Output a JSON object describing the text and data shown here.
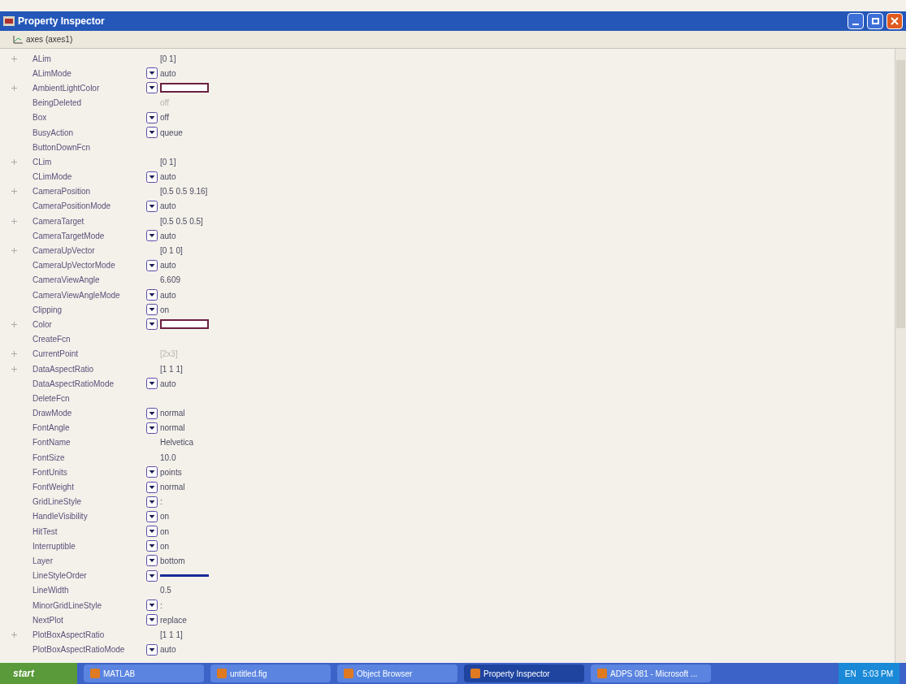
{
  "window": {
    "title": "Property Inspector"
  },
  "object": {
    "label": "axes (axes1)"
  },
  "properties": [
    {
      "name": "ALim",
      "kind": "text",
      "value": "[0 1]",
      "expanded": false,
      "disabled": false
    },
    {
      "name": "ALimMode",
      "kind": "dropdown",
      "value": "auto",
      "disabled": false
    },
    {
      "name": "AmbientLightColor",
      "kind": "color",
      "color": "#ffffff",
      "expanded": false,
      "disabled": false
    },
    {
      "name": "BeingDeleted",
      "kind": "text",
      "value": "off",
      "disabled": true
    },
    {
      "name": "Box",
      "kind": "dropdown",
      "value": "off",
      "disabled": false
    },
    {
      "name": "BusyAction",
      "kind": "dropdown",
      "value": "queue",
      "disabled": false
    },
    {
      "name": "ButtonDownFcn",
      "kind": "text",
      "disabled": false
    },
    {
      "name": "CLim",
      "kind": "text",
      "value": "[0 1]",
      "expanded": false,
      "disabled": false
    },
    {
      "name": "CLimMode",
      "kind": "dropdown",
      "value": "auto",
      "disabled": false
    },
    {
      "name": "CameraPosition",
      "kind": "text",
      "value": "[0.5 0.5 9.16]",
      "expanded": false,
      "disabled": false
    },
    {
      "name": "CameraPositionMode",
      "kind": "dropdown",
      "value": "auto",
      "disabled": false
    },
    {
      "name": "CameraTarget",
      "kind": "text",
      "value": "[0.5 0.5 0.5]",
      "expanded": false,
      "disabled": false
    },
    {
      "name": "CameraTargetMode",
      "kind": "dropdown",
      "value": "auto",
      "disabled": false
    },
    {
      "name": "CameraUpVector",
      "kind": "text",
      "value": "[0 1 0]",
      "expanded": false,
      "disabled": false
    },
    {
      "name": "CameraUpVectorMode",
      "kind": "dropdown",
      "value": "auto",
      "disabled": false
    },
    {
      "name": "CameraViewAngle",
      "kind": "text",
      "value": "6.609",
      "disabled": false
    },
    {
      "name": "CameraViewAngleMode",
      "kind": "dropdown",
      "value": "auto",
      "disabled": false
    },
    {
      "name": "Clipping",
      "kind": "dropdown",
      "value": "on",
      "disabled": false
    },
    {
      "name": "Color",
      "kind": "color",
      "color": "#ffffff",
      "expanded": false,
      "disabled": false
    },
    {
      "name": "CreateFcn",
      "kind": "text",
      "disabled": false
    },
    {
      "name": "CurrentPoint",
      "kind": "text",
      "value": "[2x3]",
      "expanded": false,
      "disabled": true
    },
    {
      "name": "DataAspectRatio",
      "kind": "text",
      "value": "[1 1 1]",
      "expanded": false,
      "disabled": false
    },
    {
      "name": "DataAspectRatioMode",
      "kind": "dropdown",
      "value": "auto",
      "disabled": false
    },
    {
      "name": "DeleteFcn",
      "kind": "text",
      "disabled": false
    },
    {
      "name": "DrawMode",
      "kind": "dropdown",
      "value": "normal",
      "disabled": false
    },
    {
      "name": "FontAngle",
      "kind": "dropdown",
      "value": "normal",
      "disabled": false
    },
    {
      "name": "FontName",
      "kind": "text",
      "value": "Helvetica",
      "disabled": false
    },
    {
      "name": "FontSize",
      "kind": "text",
      "value": "10.0",
      "disabled": false
    },
    {
      "name": "FontUnits",
      "kind": "dropdown",
      "value": "points",
      "disabled": false
    },
    {
      "name": "FontWeight",
      "kind": "dropdown",
      "value": "normal",
      "disabled": false
    },
    {
      "name": "GridLineStyle",
      "kind": "dropdown",
      "value": ":",
      "disabled": false
    },
    {
      "name": "HandleVisibility",
      "kind": "dropdown",
      "value": "on",
      "disabled": false
    },
    {
      "name": "HitTest",
      "kind": "dropdown",
      "value": "on",
      "disabled": false
    },
    {
      "name": "Interruptible",
      "kind": "dropdown",
      "value": "on",
      "disabled": false
    },
    {
      "name": "Layer",
      "kind": "dropdown",
      "value": "bottom",
      "disabled": false
    },
    {
      "name": "LineStyleOrder",
      "kind": "line",
      "disabled": false
    },
    {
      "name": "LineWidth",
      "kind": "text",
      "value": "0.5",
      "disabled": false
    },
    {
      "name": "MinorGridLineStyle",
      "kind": "dropdown",
      "value": ":",
      "disabled": false
    },
    {
      "name": "NextPlot",
      "kind": "dropdown",
      "value": "replace",
      "disabled": false
    },
    {
      "name": "PlotBoxAspectRatio",
      "kind": "text",
      "value": "[1 1 1]",
      "expanded": false,
      "disabled": false
    },
    {
      "name": "PlotBoxAspectRatioMode",
      "kind": "dropdown",
      "value": "auto",
      "disabled": false
    }
  ],
  "taskbar": {
    "start": "start",
    "items": [
      {
        "label": "MATLAB",
        "selected": false
      },
      {
        "label": "untitled.fig",
        "selected": false
      },
      {
        "label": "Object Browser",
        "selected": false
      },
      {
        "label": "Property Inspector",
        "selected": true
      },
      {
        "label": "ADPS 081 - Microsoft ...",
        "selected": false
      }
    ],
    "language": "EN",
    "clock": "5:03 PM"
  }
}
